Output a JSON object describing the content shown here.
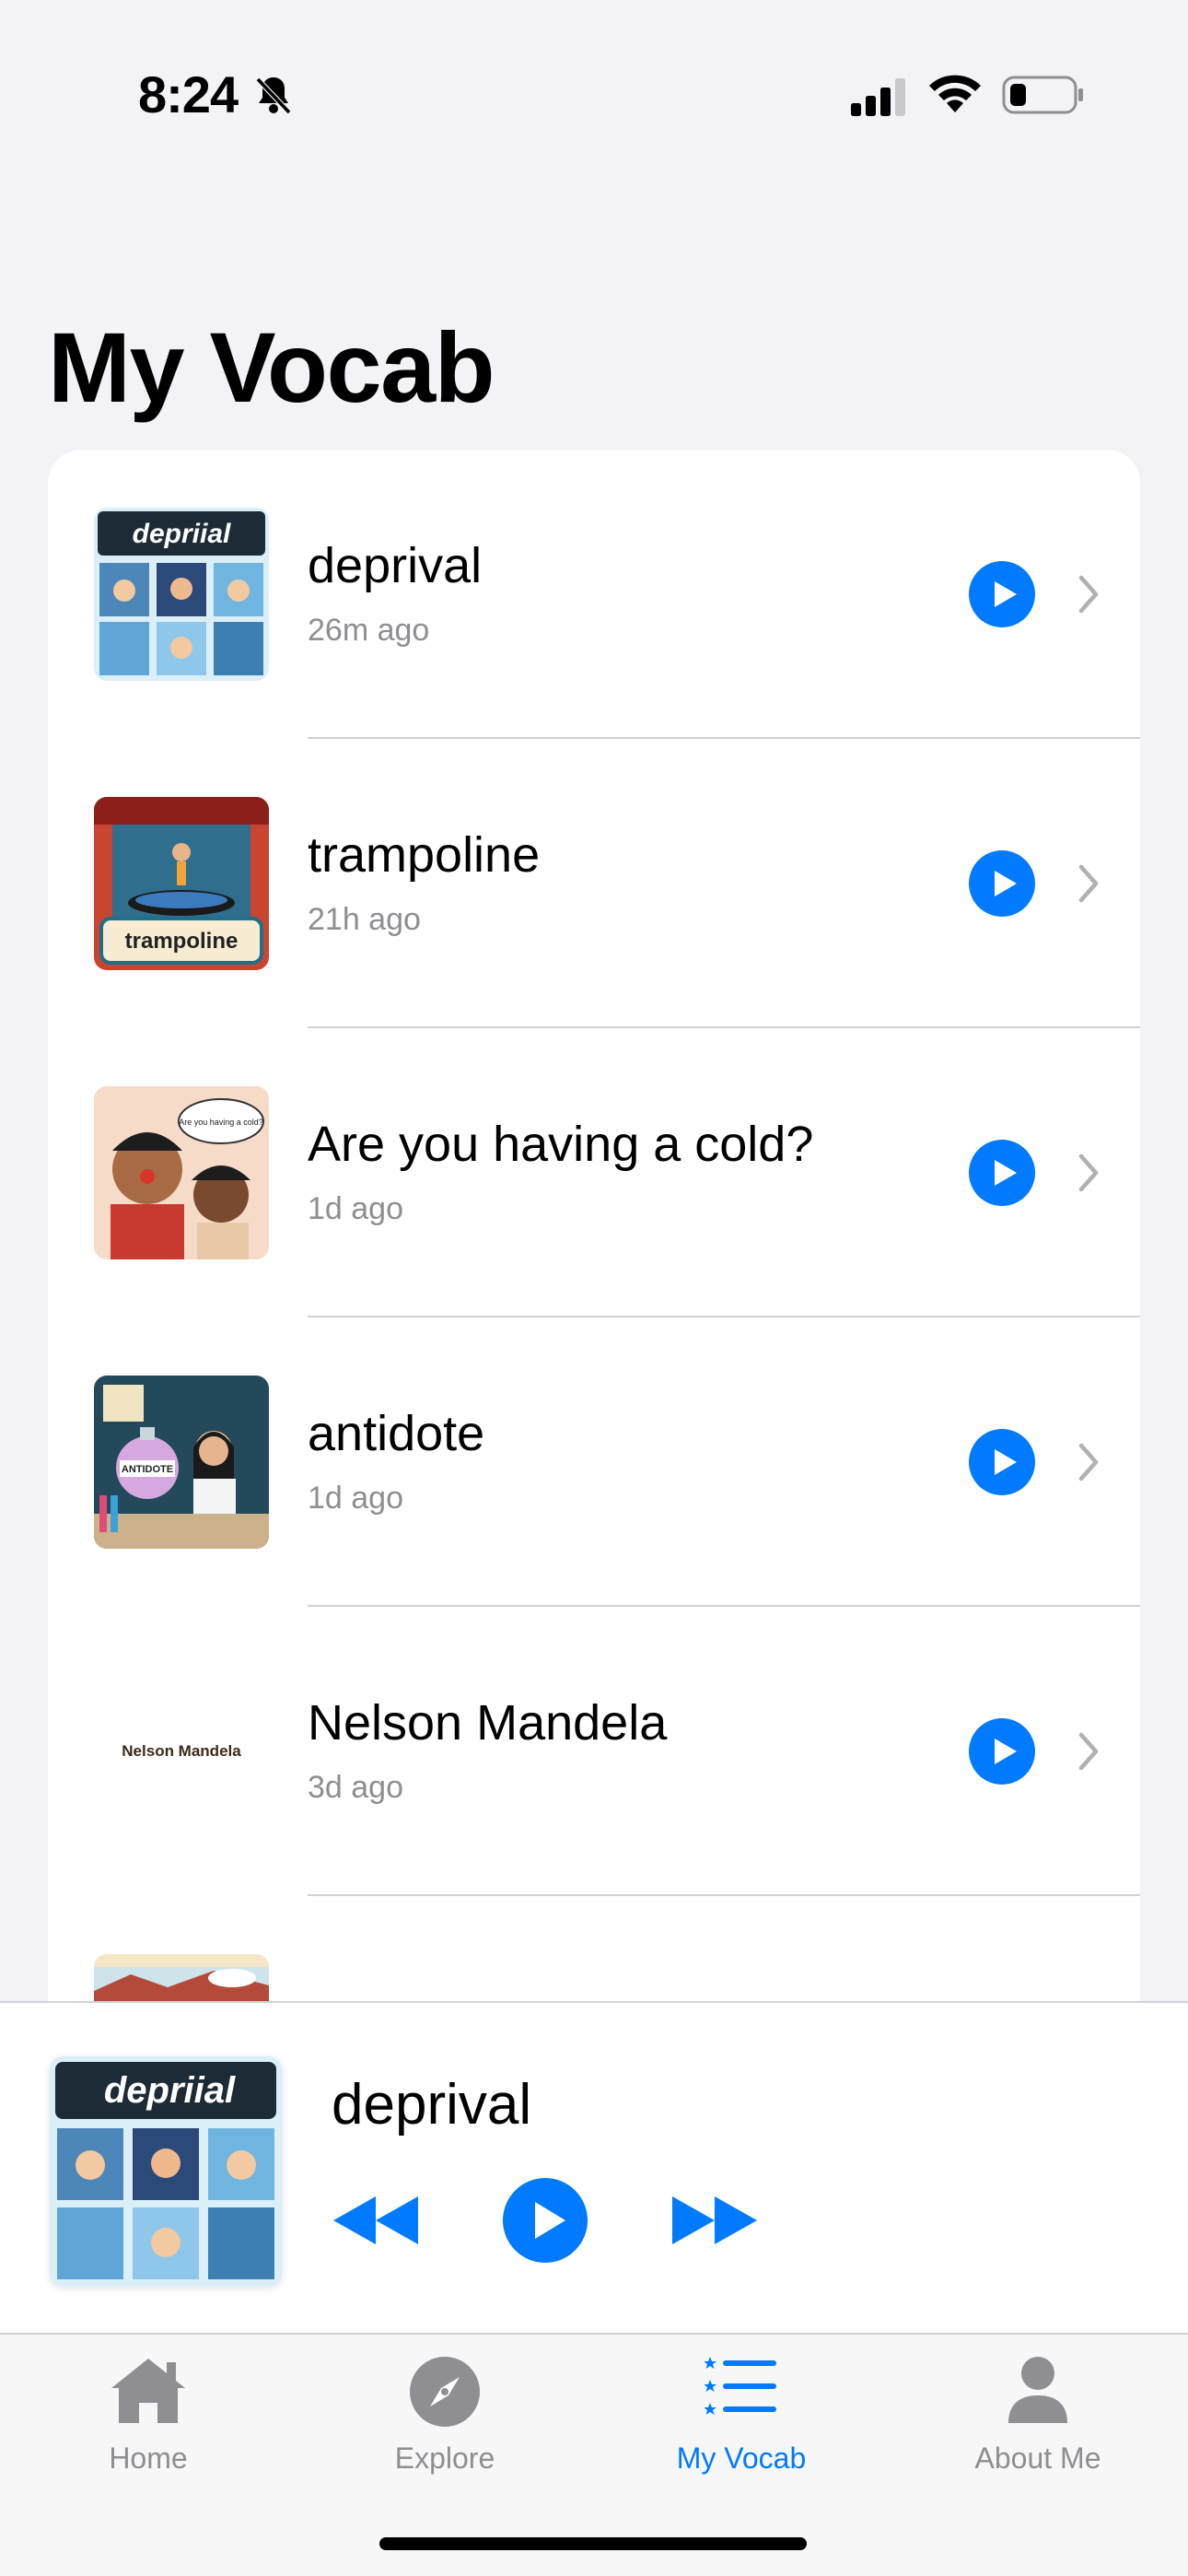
{
  "status_bar": {
    "time": "8:24",
    "icons": [
      "bell-slash-icon",
      "cellular-signal-icon",
      "wifi-icon",
      "battery-icon"
    ]
  },
  "page": {
    "title": "My Vocab"
  },
  "vocab_list": [
    {
      "word": "deprival",
      "time": "26m ago",
      "thumbnail_label": "depriial",
      "thumbnail_color": "#3aa0d8"
    },
    {
      "word": "trampoline",
      "time": "21h ago",
      "thumbnail_label": "trampoline",
      "thumbnail_color": "#c9452f"
    },
    {
      "word": "Are you having a cold?",
      "time": "1d ago",
      "thumbnail_label": "Are you having a cold?",
      "thumbnail_color": "#f3d5c0"
    },
    {
      "word": "antidote",
      "time": "1d ago",
      "thumbnail_label": "ANTIDOTE",
      "thumbnail_color": "#2a5a6a"
    },
    {
      "word": "Nelson Mandela",
      "time": "3d ago",
      "thumbnail_label": "Nelson Mandela",
      "thumbnail_color": "#ffffff"
    },
    {
      "word": ""
    }
  ],
  "mini_player": {
    "title": "deprival",
    "art_label": "depriial"
  },
  "tab_bar": {
    "tabs": [
      {
        "label": "Home",
        "icon": "house-icon",
        "active": false
      },
      {
        "label": "Explore",
        "icon": "compass-icon",
        "active": false
      },
      {
        "label": "My Vocab",
        "icon": "list-icon",
        "active": true
      },
      {
        "label": "About Me",
        "icon": "person-icon",
        "active": false
      }
    ]
  },
  "colors": {
    "accent": "#007AFF",
    "background": "#F2F2F7",
    "secondary_text": "#8E8E93",
    "separator": "#D1D1D6"
  }
}
